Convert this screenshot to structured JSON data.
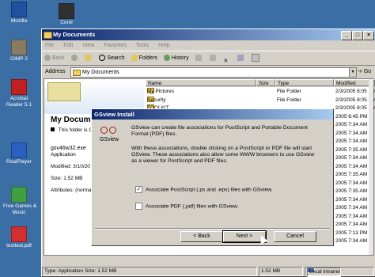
{
  "desktop": {
    "icons": [
      {
        "label": "Mozilla",
        "color": "#2050a0"
      },
      {
        "label": "GIMP 2",
        "color": "#8a7a60"
      },
      {
        "label": "Acrobat\nReader 5.1",
        "color": "#c02020"
      },
      {
        "label": "RealPlayer",
        "color": "#2a60c0"
      },
      {
        "label": "Free Games &\nMusic",
        "color": "#40a040"
      },
      {
        "label": "testtest.pdf",
        "color": "#d03030"
      },
      {
        "label": "Corel",
        "color": "#303030"
      }
    ]
  },
  "explorer": {
    "title": "My Documents",
    "menu": [
      "File",
      "Edit",
      "View",
      "Favorites",
      "Tools",
      "Help"
    ],
    "toolbar": {
      "back": "Back",
      "search": "Search",
      "folders": "Folders",
      "history": "History"
    },
    "address_label": "Address",
    "address_value": "My Documents",
    "go_label": "Go",
    "left_title": "My Documents",
    "left_info": "This folder is Online",
    "selected_file": "gsv46w32.exe",
    "selected_type": "Application",
    "modified": "Modified: 3/10/20",
    "size": "Size: 1.52 MB",
    "attributes": "Attributes: (norma",
    "columns": [
      "Name",
      "Size",
      "Type",
      "Modified"
    ],
    "rows": [
      {
        "name": "My Pictures",
        "type": "File Folder",
        "modified": "2/3/2005 8:05 PM"
      },
      {
        "name": "Security",
        "type": "File Folder",
        "modified": "2/3/2005 8:05 PM"
      },
      {
        "name": "TOOLKIT",
        "type": "",
        "modified": "2/3/2005 8:05 PM"
      },
      {
        "name": "",
        "type": "",
        "modified": "2005 6:45 PM"
      },
      {
        "name": "",
        "type": "",
        "modified": "2005 7:34 AM"
      },
      {
        "name": "",
        "type": "",
        "modified": "2005 7:34 AM"
      },
      {
        "name": "",
        "type": "",
        "modified": "2005 7:34 AM"
      },
      {
        "name": "",
        "type": "",
        "modified": "2005 7:35 AM"
      },
      {
        "name": "",
        "type": "",
        "modified": "2005 7:34 AM"
      },
      {
        "name": "",
        "type": "",
        "modified": "2005 7:34 AM"
      },
      {
        "name": "",
        "type": "",
        "modified": "2005 7:35 AM"
      },
      {
        "name": "",
        "type": "",
        "modified": "2005 7:34 AM"
      },
      {
        "name": "",
        "type": "",
        "modified": "2005 7:35 AM"
      },
      {
        "name": "",
        "type": "",
        "modified": "2005 7:34 AM"
      },
      {
        "name": "",
        "type": "",
        "modified": "2005 7:34 AM"
      },
      {
        "name": "",
        "type": "",
        "modified": "2005 7:34 AM"
      },
      {
        "name": "",
        "type": "",
        "modified": "2005 7:34 AM"
      },
      {
        "name": "",
        "type": "",
        "modified": "2005 7:13 PM"
      },
      {
        "name": "",
        "type": "",
        "modified": "2005 7:34 AM"
      }
    ],
    "status_left": "Type: Application Size: 1.52 MB",
    "status_mid": "1.52 MB",
    "status_right": "Local intranet"
  },
  "dialog": {
    "title": "GSview Install",
    "logo_name": "GSview",
    "text1": "GSview can create file associations for PostScript and Portable Document Format (PDF) files.",
    "text2": "With these associations, double clicking on a PostScript or PDF file will start GSview.  These associations also allow some WWW browsers to use GSview as a viewer for PostScript and PDF files.",
    "check_ps": "Associate PostScript (.ps and .eps) files with GSview.",
    "check_ps_checked": true,
    "check_pdf": "Associate PDF (.pdf) files with GSview.",
    "check_pdf_checked": false,
    "back": "< Back",
    "next": "Next >",
    "cancel": "Cancel"
  }
}
